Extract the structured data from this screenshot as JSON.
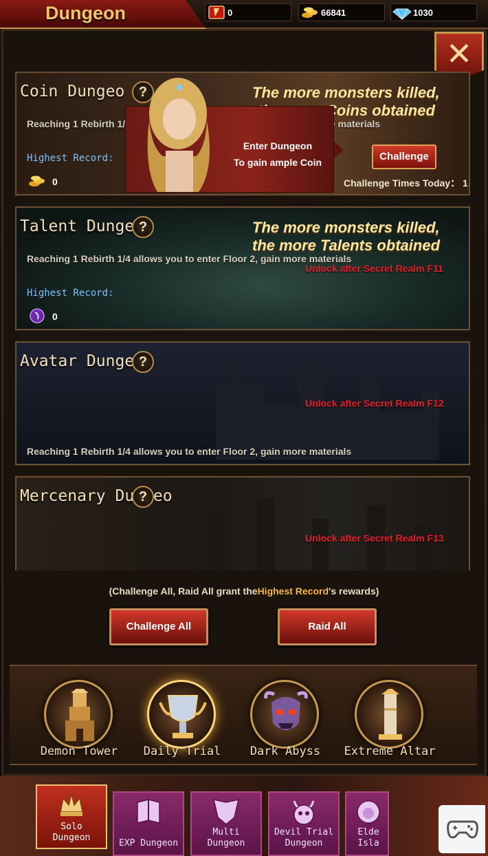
{
  "header": {
    "title": "Dungeon"
  },
  "resources": [
    {
      "icon": "red-ticket-icon",
      "value": "0"
    },
    {
      "icon": "gold-coins-icon",
      "value": "66841"
    },
    {
      "icon": "diamond-icon",
      "value": "1030"
    }
  ],
  "dungeons": [
    {
      "title": "Coin Dungeo",
      "slogan_line1": "The more monsters killed,",
      "slogan_line2": "the more Coins obtained",
      "desc": "Reaching 1 Rebirth 1/4 allo",
      "desc_tail": "nter Floor 2, gain more materials",
      "record_label": "Highest Record:",
      "record_value": "0",
      "record_icon": "gold-coins-icon",
      "popup_line1": "Enter Dungeon",
      "popup_line2": "To gain ample Coin",
      "challenge_label": "Challenge",
      "times_label": "Challenge Times Today： 1"
    },
    {
      "title": "Talent Dungeo",
      "slogan_line1": "The more monsters killed,",
      "slogan_line2": "the more Talents obtained",
      "desc": "Reaching 1 Rebirth 1/4 allows you to enter Floor 2, gain more materials",
      "record_label": "Highest Record:",
      "record_value": "0",
      "record_icon": "purple-orb-icon",
      "lock_text": "Unlock after Secret Realm F11"
    },
    {
      "title": "Avatar Dungeo",
      "desc": "Reaching 1 Rebirth 1/4 allows you to enter Floor 2, gain more materials",
      "lock_text": "Unlock after Secret Realm F12"
    },
    {
      "title": "Mercenary Dungeo",
      "lock_text": "Unlock after Secret Realm F13"
    }
  ],
  "note": {
    "prefix": "(Challenge All, Raid All grant the",
    "highlight": "Highest Record",
    "suffix": "'s rewards)"
  },
  "actions": {
    "challenge_all": "Challenge All",
    "raid_all": "Raid All"
  },
  "categories": [
    {
      "label": "Demon Tower",
      "icon": "tower-icon"
    },
    {
      "label": "Daily Trial",
      "icon": "trophy-icon",
      "active": true
    },
    {
      "label": "Dark Abyss",
      "icon": "demon-skull-icon"
    },
    {
      "label": "Extreme Altar",
      "icon": "altar-icon"
    }
  ],
  "nav": [
    {
      "line1": "Solo",
      "line2": "Dungeon",
      "icon": "crown-icon",
      "active": true
    },
    {
      "line1": "",
      "line2": "EXP Dungeon",
      "icon": "book-icon"
    },
    {
      "line1": "Multi",
      "line2": "Dungeon",
      "icon": "wings-icon"
    },
    {
      "line1": "Devil Trial",
      "line2": "Dungeon",
      "icon": "devil-icon"
    },
    {
      "line1": "Elde",
      "line2": "Isla",
      "icon": "lion-icon"
    }
  ],
  "colors": {
    "accent_gold": "#f2c46a",
    "lock_red": "#e4202a",
    "record_blue": "#7fc0ff",
    "button_red": "#c0301e"
  }
}
